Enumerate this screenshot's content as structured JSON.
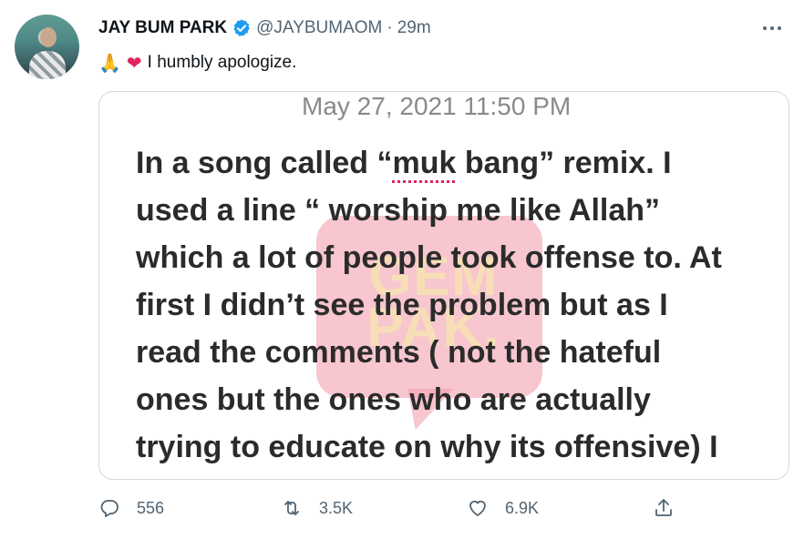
{
  "tweet": {
    "author_name": "JAY BUM PARK",
    "handle": "@JAYBUMAOM",
    "separator": "·",
    "time": "29m",
    "emojis": [
      "🙏",
      "❤"
    ],
    "text": "I humbly apologize."
  },
  "media": {
    "date": "May 27, 2021 11:50 PM",
    "lines": [
      {
        "before": "In a song called “",
        "flagged": "muk",
        "after": " bang” remix. I"
      },
      {
        "text": "used a line “ worship me like Allah”"
      },
      {
        "text": "which a lot of people took offense to. At"
      },
      {
        "text": "first I didn’t see the problem but as I"
      },
      {
        "text": "read the comments ( not the hateful"
      },
      {
        "text": "ones but the ones who are actually"
      },
      {
        "text": "trying to educate on why its offensive) I"
      }
    ],
    "watermark_line1": "GEM",
    "watermark_line2": "PAK."
  },
  "actions": {
    "replies": "556",
    "retweets": "3.5K",
    "likes": "6.9K"
  },
  "colors": {
    "verified_blue": "#1d9bf0",
    "heart_red": "#e0245e",
    "secondary_text": "#536471",
    "watermark_pink": "#f2a0ae"
  }
}
